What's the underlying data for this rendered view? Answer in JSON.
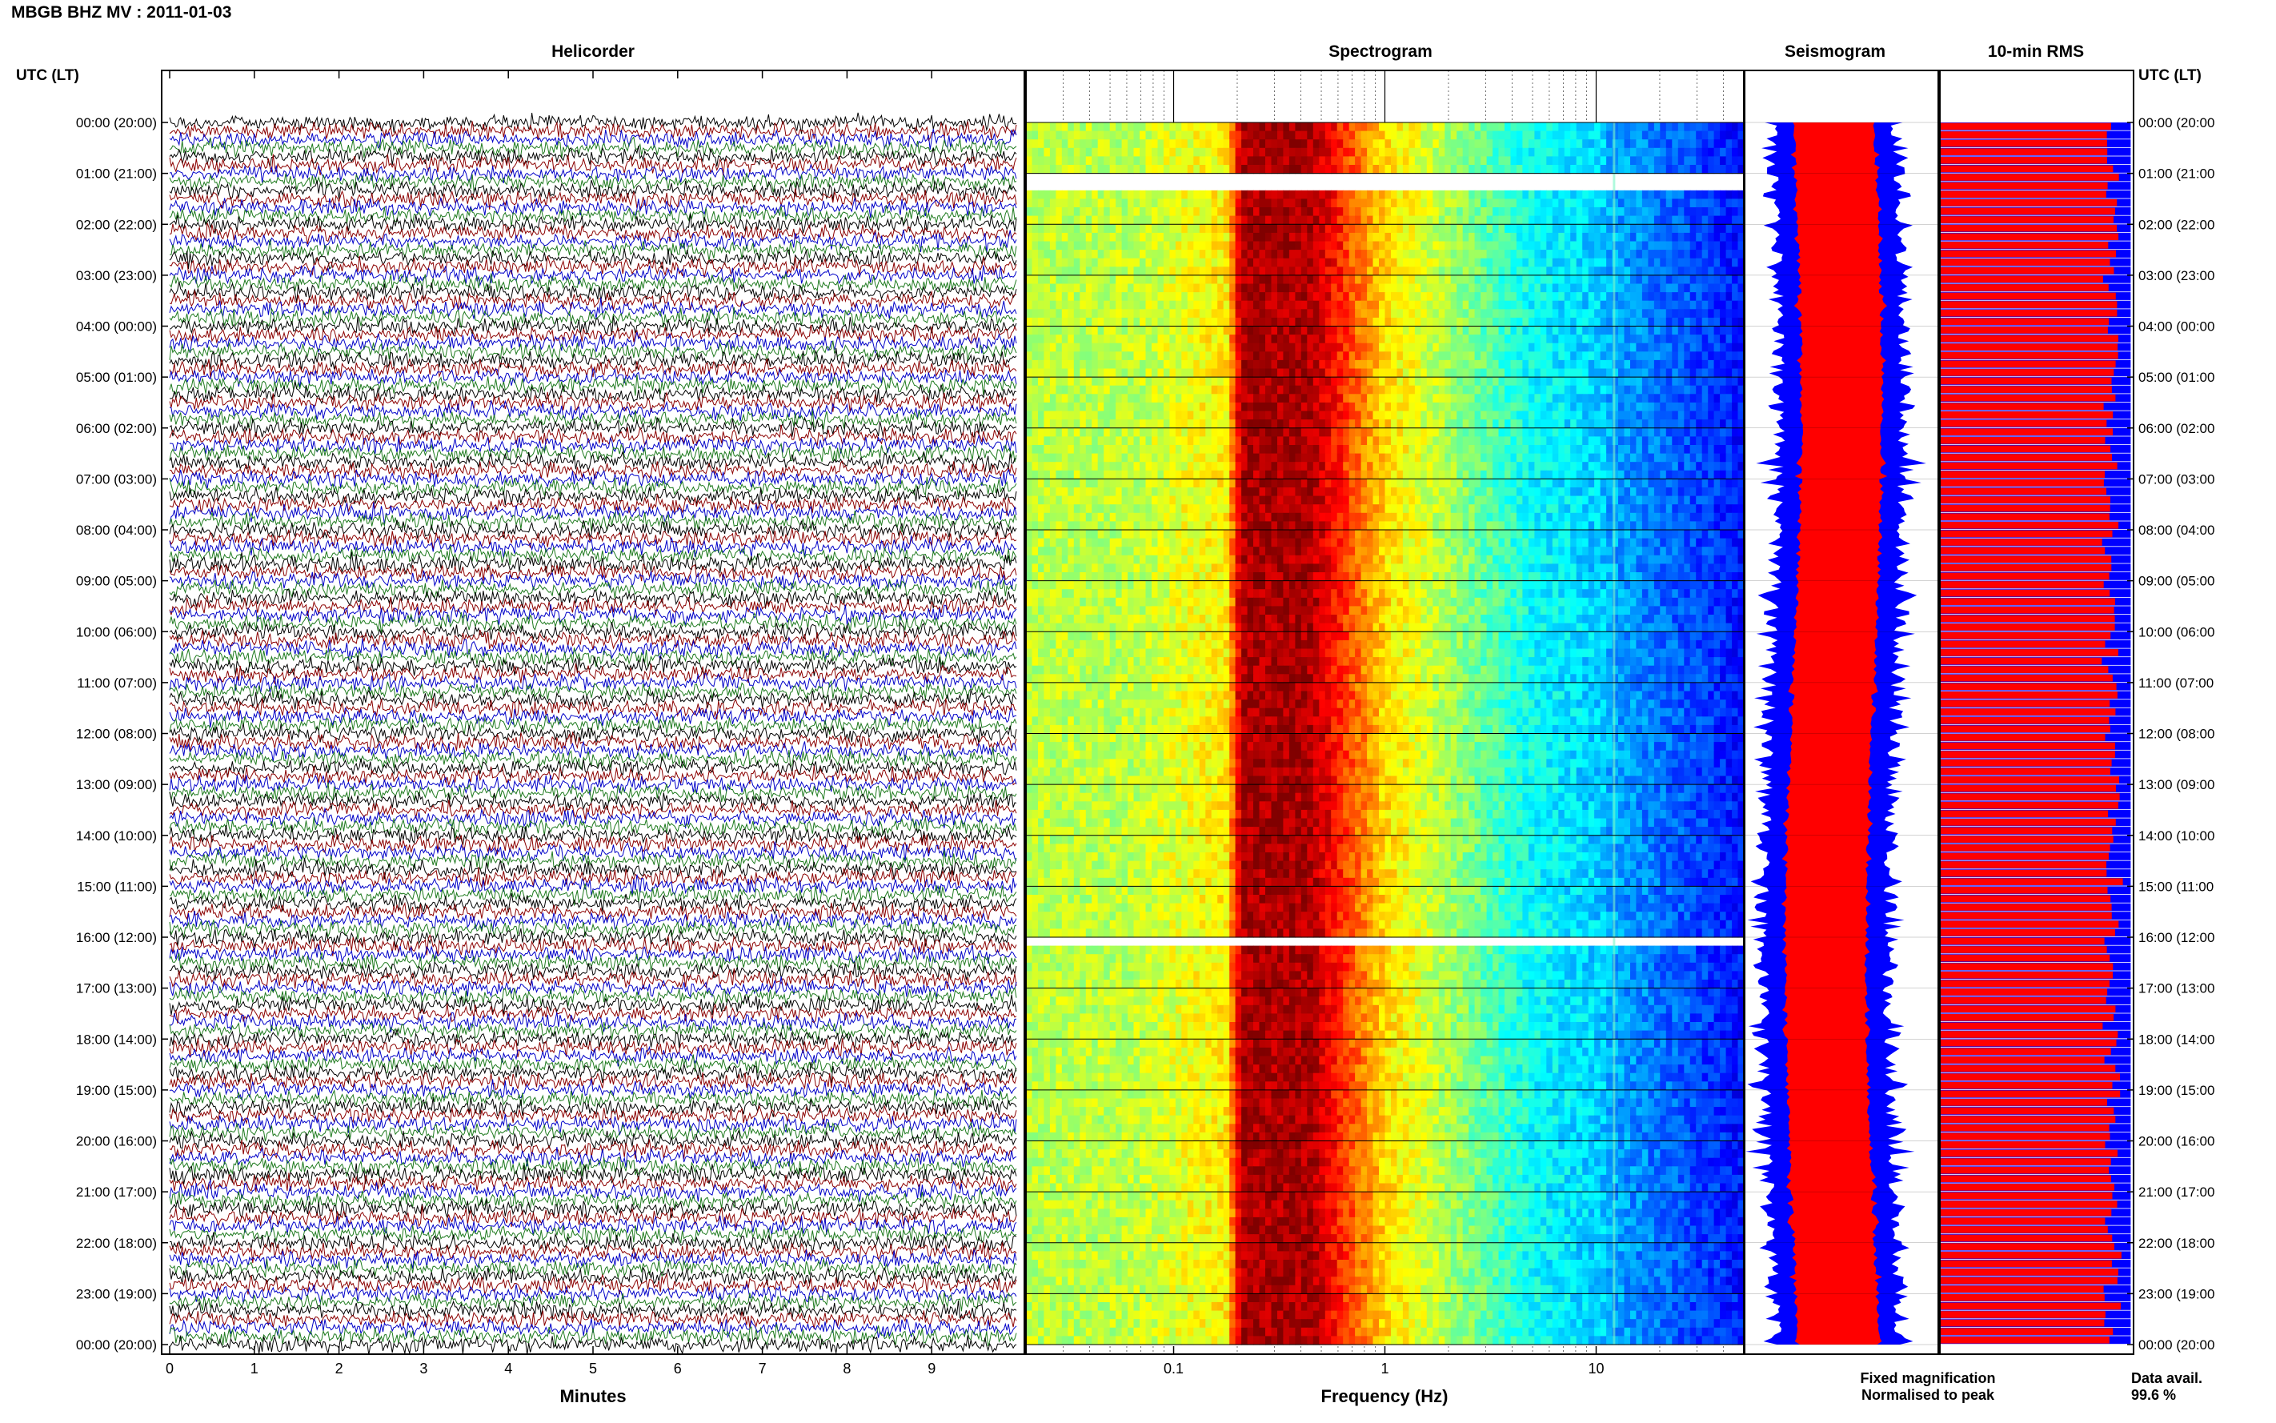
{
  "header": {
    "title": "MBGB BHZ MV : 2011-01-03",
    "time_axis_label_left": "UTC (LT)",
    "time_axis_label_right": "UTC (LT)"
  },
  "panels": {
    "helicorder": "Helicorder",
    "spectrogram": "Spectrogram",
    "seismogram": "Seismogram",
    "rms": "10-min RMS"
  },
  "legend": {
    "fixed": "Fixed magnification",
    "normalised": "Normalised to peak",
    "data_avail_label": "Data avail.",
    "data_avail_value": "99.6 %"
  },
  "colors": {
    "fixed": "#0000ff",
    "normalised": "#ff0000",
    "trace_colors": [
      "#000000",
      "#8b0000",
      "#0000c8",
      "#1e7a1e"
    ],
    "spectrogram_colormap": "jet"
  },
  "chart_data": [
    {
      "type": "line",
      "panel": "Helicorder",
      "xlabel": "Minutes",
      "xlim": [
        0,
        10
      ],
      "x_ticks": [
        "0",
        "1",
        "2",
        "3",
        "4",
        "5",
        "6",
        "7",
        "8",
        "9"
      ],
      "rows_per_hour": 6,
      "y_tick_labels": [
        "00:00 (20:00)",
        "01:00 (21:00)",
        "02:00 (22:00)",
        "03:00 (23:00)",
        "04:00 (00:00)",
        "05:00 (01:00)",
        "06:00 (02:00)",
        "07:00 (03:00)",
        "08:00 (04:00)",
        "09:00 (05:00)",
        "10:00 (06:00)",
        "11:00 (07:00)",
        "12:00 (08:00)",
        "13:00 (09:00)",
        "14:00 (10:00)",
        "15:00 (11:00)",
        "16:00 (12:00)",
        "17:00 (13:00)",
        "18:00 (14:00)",
        "19:00 (15:00)",
        "20:00 (16:00)",
        "21:00 (17:00)",
        "22:00 (18:00)",
        "23:00 (19:00)",
        "00:00 (20:00)"
      ]
    },
    {
      "type": "heatmap",
      "panel": "Spectrogram",
      "xlabel": "Frequency (Hz)",
      "xscale": "log",
      "xlim": [
        0.02,
        50
      ],
      "x_tick_labels": [
        "0.1",
        "1",
        "10"
      ],
      "peak_band_hz": [
        0.2,
        0.5
      ],
      "gaps_utc": [
        "01:05",
        "16:00"
      ]
    },
    {
      "type": "area",
      "panel": "Seismogram",
      "series": [
        {
          "name": "Fixed magnification",
          "color": "#0000ff"
        },
        {
          "name": "Normalised to peak",
          "color": "#ff0000"
        }
      ]
    },
    {
      "type": "bar",
      "panel": "10-min RMS",
      "orientation": "horizontal",
      "bars_per_hour": 6,
      "blue_fraction": 1.0,
      "red_fraction_mean": 0.9
    }
  ]
}
